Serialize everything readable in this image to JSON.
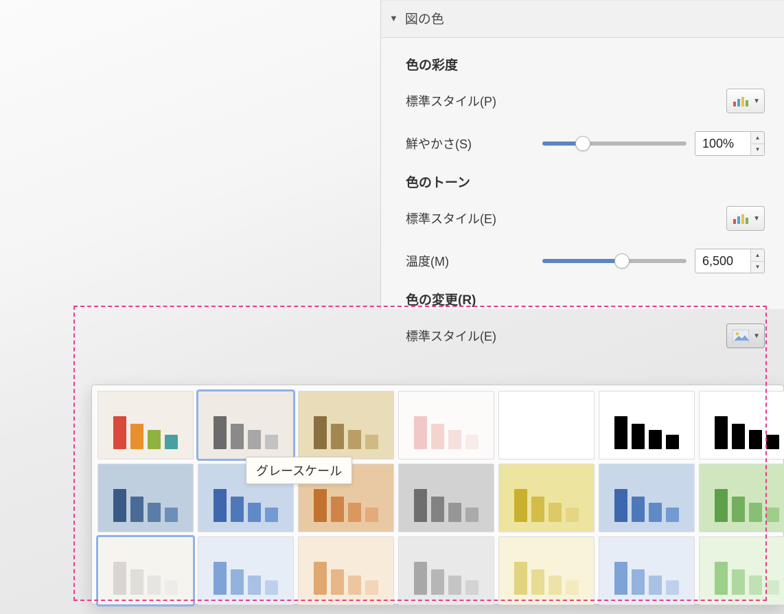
{
  "panel": {
    "section_title": "図の色",
    "saturation": {
      "heading": "色の彩度",
      "preset_label": "標準スタイル(P)",
      "vividness_label": "鮮やかさ(S)",
      "vividness_value": "100%",
      "slider_fill_pct": 28
    },
    "tone": {
      "heading": "色のトーン",
      "preset_label": "標準スタイル(E)",
      "temperature_label": "温度(M)",
      "temperature_value": "6,500",
      "slider_fill_pct": 55
    },
    "recolor": {
      "heading": "色の変更(R)",
      "preset_label": "標準スタイル(E)"
    }
  },
  "tooltip": "グレースケール",
  "gallery": {
    "selected_indices": [
      1,
      14
    ],
    "swatches": [
      {
        "tint": null,
        "bars": [
          "#d94a3b",
          "#e98f2e",
          "#8fb23e",
          "#4aa0a0"
        ],
        "bg": "#f3eee8"
      },
      {
        "tint": "grayscale",
        "bars": [
          "#6b6b6b",
          "#8a8a8a",
          "#a7a7a7",
          "#c2c2c2"
        ],
        "bg": "#efeae3"
      },
      {
        "tint": "sepia",
        "bars": [
          "#8a7040",
          "#a38750",
          "#b99f67",
          "#d0b982"
        ],
        "bg": "#e9dcb9"
      },
      {
        "tint": "washout-pink",
        "bars": [
          "#f2c8c6",
          "#f4d4cf",
          "#f6e0dc",
          "#f8ece9"
        ],
        "bg": "#fdfafa"
      },
      {
        "tint": "white",
        "bars": [
          "#ffffff",
          "#ffffff",
          "#ffffff",
          "#ffffff"
        ],
        "bg": "#ffffff"
      },
      {
        "tint": "bw",
        "bars": [
          "#000000",
          "#000000",
          "#000000",
          "#000000"
        ],
        "bg": "#ffffff"
      },
      {
        "tint": "bw2",
        "bars": [
          "#000000",
          "#000000",
          "#000000",
          "#000000"
        ],
        "bg": "#ffffff"
      },
      {
        "tint": "blue-dark",
        "bars": [
          "#3a5a85",
          "#4a6b96",
          "#5b7da7",
          "#6d8eb8"
        ],
        "bg": "#bfcfdf"
      },
      {
        "tint": "blue",
        "bars": [
          "#3e67ae",
          "#4f78bb",
          "#6089c7",
          "#739ad3"
        ],
        "bg": "#c9d7ea"
      },
      {
        "tint": "orange",
        "bars": [
          "#c2722f",
          "#cf8445",
          "#da975e",
          "#e4aa79"
        ],
        "bg": "#e9c9a3"
      },
      {
        "tint": "gray",
        "bars": [
          "#6e6e6e",
          "#828282",
          "#969696",
          "#aaaaaa"
        ],
        "bg": "#d2d2d2"
      },
      {
        "tint": "yellow",
        "bars": [
          "#c9b02e",
          "#d3bd48",
          "#ddc965",
          "#e6d582"
        ],
        "bg": "#ede59f"
      },
      {
        "tint": "blue2",
        "bars": [
          "#3e67ae",
          "#4f78bb",
          "#6089c7",
          "#739ad3"
        ],
        "bg": "#c9d7ea"
      },
      {
        "tint": "green",
        "bars": [
          "#5ea04a",
          "#72b05e",
          "#87bf74",
          "#9dce8b"
        ],
        "bg": "#cfe6bf"
      },
      {
        "tint": "washout-gray",
        "bars": [
          "#d8d6d2",
          "#e0ded9",
          "#e7e5e1",
          "#eeece8"
        ],
        "bg": "#f6f4ef"
      },
      {
        "tint": "light-blue",
        "bars": [
          "#7fa3d6",
          "#93b2dd",
          "#a8c1e4",
          "#bdd1eb"
        ],
        "bg": "#e6edf6"
      },
      {
        "tint": "light-orange",
        "bars": [
          "#e1a771",
          "#e7b687",
          "#edc59e",
          "#f3d5b7"
        ],
        "bg": "#f8ebd9"
      },
      {
        "tint": "light-gray",
        "bars": [
          "#a8a8a8",
          "#b6b6b6",
          "#c5c5c5",
          "#d3d3d3"
        ],
        "bg": "#e9e9e9"
      },
      {
        "tint": "light-yellow",
        "bars": [
          "#e2d47e",
          "#e8db93",
          "#eee2a9",
          "#f3eac0"
        ],
        "bg": "#f8f3d9"
      },
      {
        "tint": "light-blue2",
        "bars": [
          "#7fa3d6",
          "#93b2dd",
          "#a8c1e4",
          "#bdd1eb"
        ],
        "bg": "#e6edf6"
      },
      {
        "tint": "light-green",
        "bars": [
          "#9ccf8a",
          "#aed89f",
          "#c0e1b4",
          "#d3eaca"
        ],
        "bg": "#e9f4e1"
      }
    ]
  }
}
